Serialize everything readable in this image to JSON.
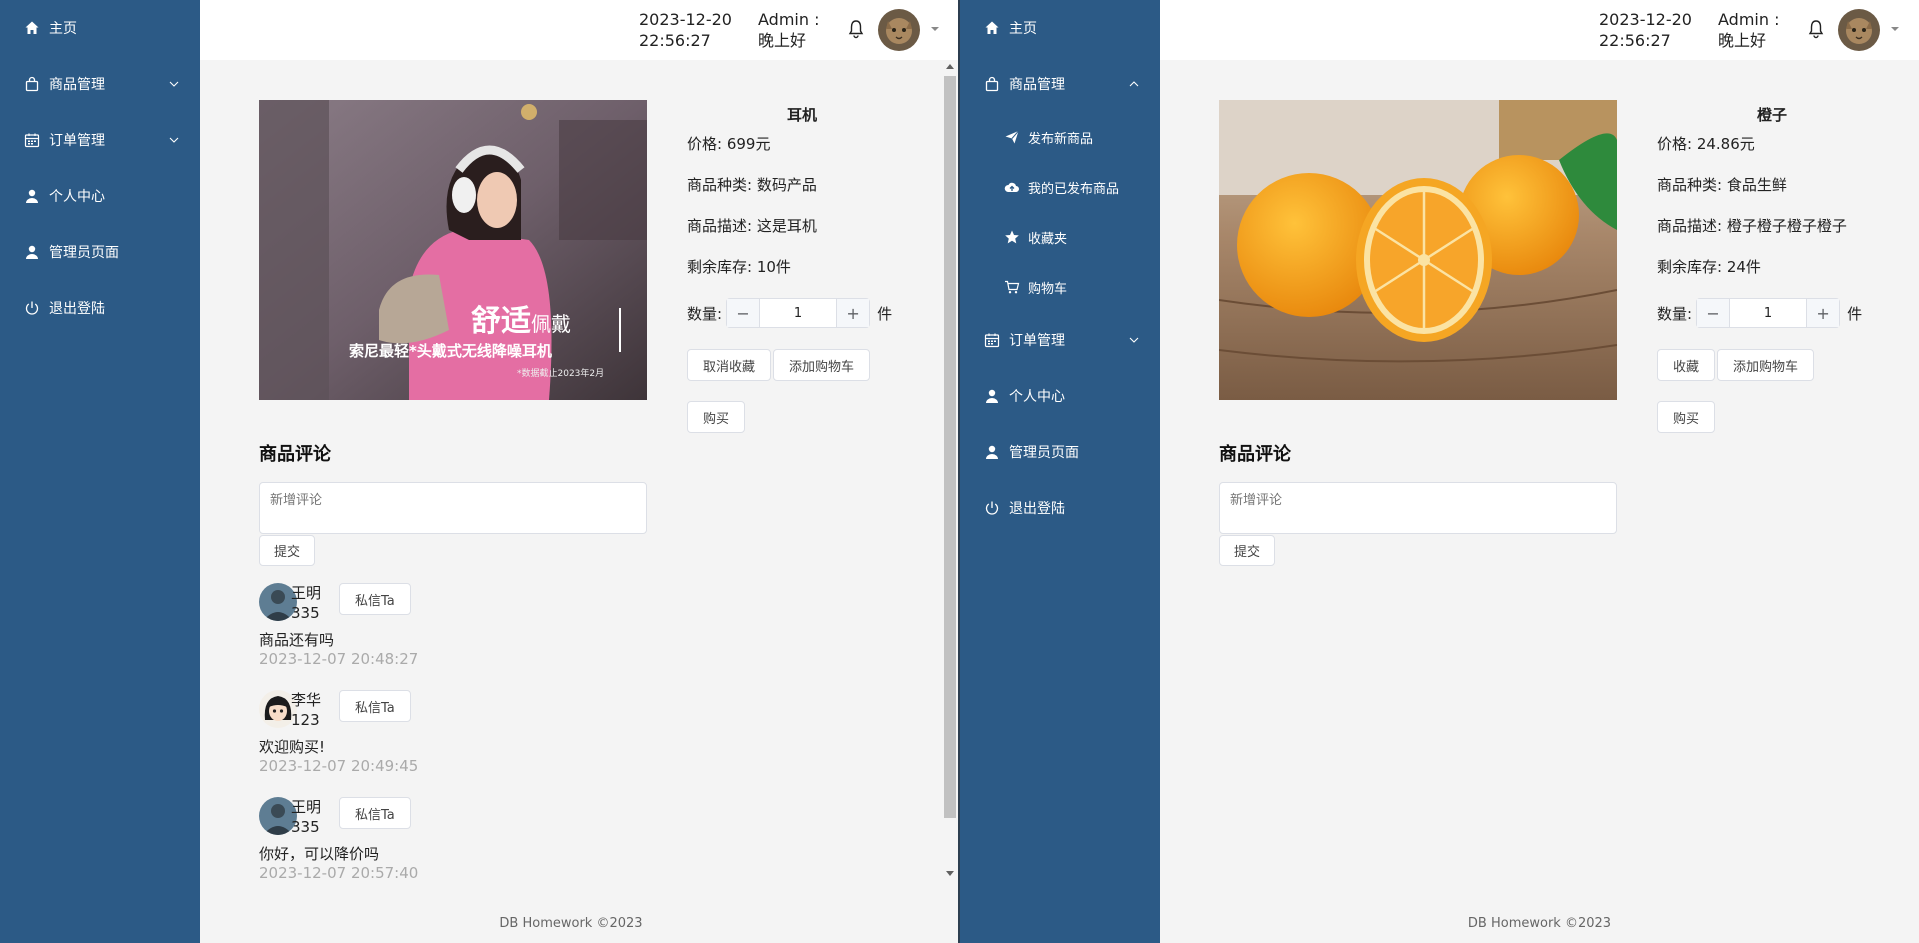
{
  "colors": {
    "sidebar_bg": "#2c5a86",
    "content_bg": "#f4f4f4",
    "header_bg": "#ffffff"
  },
  "left": {
    "sidebar": {
      "items": [
        {
          "label": "主页",
          "icon": "home-icon"
        },
        {
          "label": "商品管理",
          "icon": "bag-icon"
        },
        {
          "label": "订单管理",
          "icon": "calendar-icon"
        },
        {
          "label": "个人中心",
          "icon": "user-icon"
        },
        {
          "label": "管理员页面",
          "icon": "user-icon"
        },
        {
          "label": "退出登陆",
          "icon": "power-icon"
        }
      ]
    },
    "header": {
      "date": "2023-12-20",
      "time": "22:56:27",
      "greeting": "Admin : 晚上好"
    },
    "product": {
      "name": "耳机",
      "price": "价格: 699元",
      "category": "商品种类: 数码产品",
      "description": "商品描述: 这是耳机",
      "stock": "剩余库存: 10件",
      "qty_label": "数量:",
      "qty_value": "1",
      "qty_unit": "件",
      "fav_label": "取消收藏",
      "cart_label": "添加购物车",
      "buy_label": "购买",
      "image_text_big": "舒适",
      "image_text_small": "佩戴",
      "image_text_sub": "索尼最轻*头戴式无线降噪耳机",
      "image_text_note": "*数据截止2023年2月"
    },
    "review": {
      "title": "商品评论",
      "placeholder": "新增评论",
      "submit": "提交",
      "comments": [
        {
          "user": "王明335",
          "button": "私信Ta",
          "text": "商品还有吗",
          "time": "2023-12-07 20:48:27"
        },
        {
          "user": "李华123",
          "button": "私信Ta",
          "text": "欢迎购买!",
          "time": "2023-12-07 20:49:45"
        },
        {
          "user": "王明335",
          "button": "私信Ta",
          "text": "你好，可以降价吗",
          "time": "2023-12-07 20:57:40"
        }
      ]
    },
    "footer": "DB Homework ©2023"
  },
  "right": {
    "sidebar": {
      "items": [
        {
          "label": "主页",
          "icon": "home-icon"
        },
        {
          "label": "商品管理",
          "icon": "bag-icon"
        },
        {
          "label": "订单管理",
          "icon": "calendar-icon"
        },
        {
          "label": "个人中心",
          "icon": "user-icon"
        },
        {
          "label": "管理员页面",
          "icon": "user-icon"
        },
        {
          "label": "退出登陆",
          "icon": "power-icon"
        }
      ],
      "submenu": [
        {
          "label": "发布新商品",
          "icon": "send-icon"
        },
        {
          "label": "我的已发布商品",
          "icon": "cloud-upload-icon"
        },
        {
          "label": "收藏夹",
          "icon": "star-icon"
        },
        {
          "label": "购物车",
          "icon": "cart-icon"
        }
      ]
    },
    "header": {
      "date": "2023-12-20",
      "time": "22:56:27",
      "greeting": "Admin : 晚上好"
    },
    "product": {
      "name": "橙子",
      "price": "价格: 24.86元",
      "category": "商品种类: 食品生鲜",
      "description": "商品描述: 橙子橙子橙子橙子",
      "stock": "剩余库存: 24件",
      "qty_label": "数量:",
      "qty_value": "1",
      "qty_unit": "件",
      "fav_label": "收藏",
      "cart_label": "添加购物车",
      "buy_label": "购买"
    },
    "review": {
      "title": "商品评论",
      "placeholder": "新增评论",
      "submit": "提交"
    },
    "footer": "DB Homework ©2023"
  }
}
